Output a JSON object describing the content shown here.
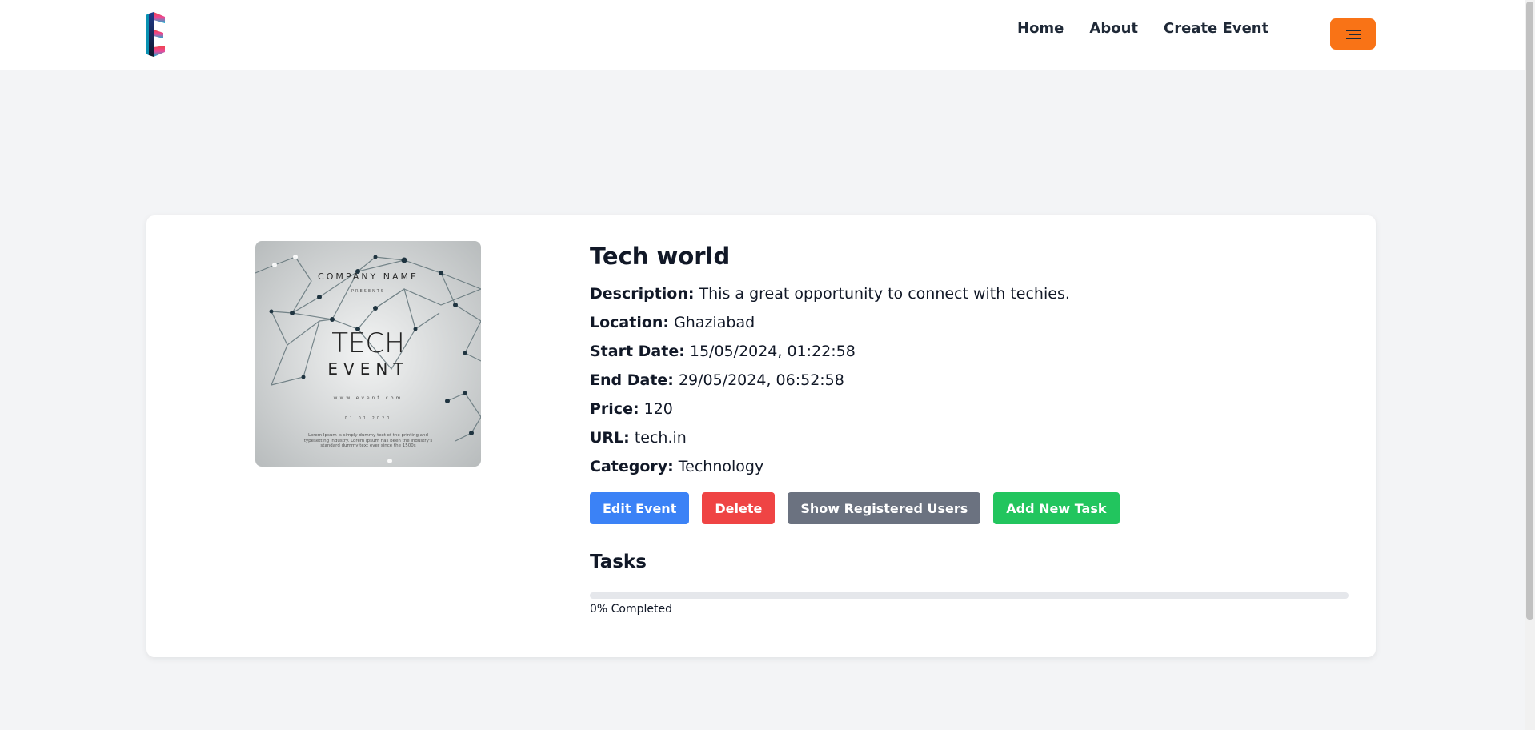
{
  "nav": {
    "links": [
      "Home",
      "About",
      "Create Event"
    ],
    "menu_icon": "hamburger-icon",
    "accent_color": "#f97316"
  },
  "event": {
    "image_alt": "Tech event poster",
    "poster": {
      "company": "COMPANY NAME",
      "presents": "PRESENTS",
      "headline": "TECH",
      "subheadline": "EVENT",
      "website": "www.event.com",
      "date": "01.01.2020",
      "body": "Lorem Ipsum is simply dummy text of the printing and typesetting industry. Lorem Ipsum has been the industry's standard dummy text ever since the 1500s"
    },
    "title": "Tech world",
    "fields": [
      {
        "label": "Description:",
        "value": "This a great opportunity to connect with techies."
      },
      {
        "label": "Location:",
        "value": "Ghaziabad"
      },
      {
        "label": "Start Date:",
        "value": "15/05/2024, 01:22:58"
      },
      {
        "label": "End Date:",
        "value": "29/05/2024, 06:52:58"
      },
      {
        "label": "Price:",
        "value": "120"
      },
      {
        "label": "URL:",
        "value": "tech.in"
      },
      {
        "label": "Category:",
        "value": "Technology"
      }
    ],
    "actions": {
      "edit": "Edit Event",
      "delete": "Delete",
      "users": "Show Registered Users",
      "add_task": "Add New Task"
    },
    "tasks": {
      "heading": "Tasks",
      "progress_percent": 0,
      "progress_label": "0% Completed"
    }
  }
}
